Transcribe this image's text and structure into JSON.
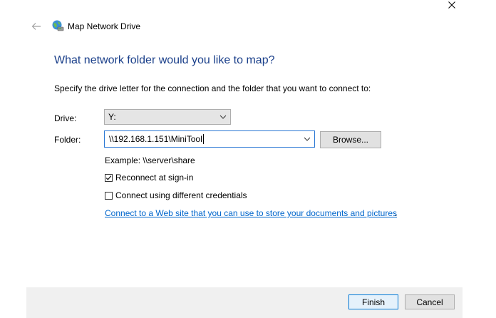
{
  "window": {
    "title": "Map Network Drive",
    "icons": {
      "close": "close-icon",
      "back": "back-arrow-icon",
      "app": "network-drive-icon"
    }
  },
  "main": {
    "heading": "What network folder would you like to map?",
    "instruction": "Specify the drive letter for the connection and the folder that you want to connect to:",
    "drive": {
      "label": "Drive:",
      "value": "Y:"
    },
    "folder": {
      "label": "Folder:",
      "value": "\\\\192.168.1.151\\MiniTool"
    },
    "browse_label": "Browse...",
    "example": "Example: \\\\server\\share",
    "reconnect": {
      "label": "Reconnect at sign-in",
      "checked": true
    },
    "different_credentials": {
      "label": "Connect using different credentials",
      "checked": false
    },
    "web_link": "Connect to a Web site that you can use to store your documents and pictures",
    "web_link_suffix": "."
  },
  "footer": {
    "finish_label": "Finish",
    "cancel_label": "Cancel"
  },
  "colors": {
    "heading": "#1a3f8a",
    "link": "#0066cc",
    "accent": "#0078d7",
    "footer_bg": "#f0f0f0"
  }
}
